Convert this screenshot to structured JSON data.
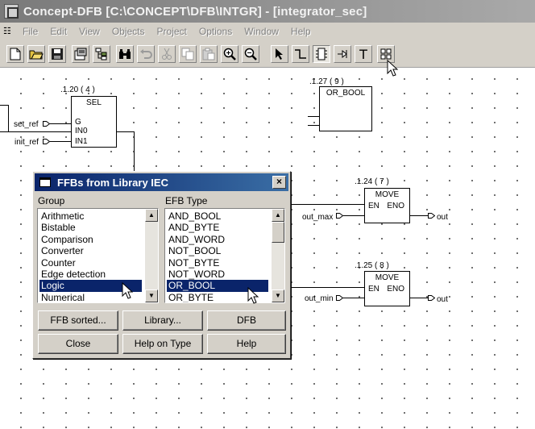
{
  "window": {
    "title": "Concept-DFB [C:\\CONCEPT\\DFB\\INTGR]  - [integrator_sec]"
  },
  "menu": [
    "File",
    "Edit",
    "View",
    "Objects",
    "Project",
    "Options",
    "Window",
    "Help"
  ],
  "toolbar": {
    "icons": [
      "new-file-icon",
      "open-folder-icon",
      "save-icon",
      "properties-icon",
      "hierarchy-icon",
      "binoculars-icon",
      "undo-icon",
      "cut-icon",
      "copy-icon",
      "paste-icon",
      "zoom-in-icon",
      "zoom-out-icon",
      "select-arrow-icon",
      "connect-link-icon",
      "ffb-block-icon",
      "pin-icon",
      "text-icon",
      "ffb-library-icon"
    ],
    "text_tool": "T"
  },
  "diagram": {
    "sel_block": {
      "ref": ".1.20 ( 4 )",
      "title": "SEL",
      "pins": [
        "G",
        "IN0",
        "IN1"
      ]
    },
    "or_block": {
      "ref": ".1.27 ( 9 )",
      "title": "OR_BOOL"
    },
    "move1": {
      "ref": ".1.24 ( 7 )",
      "title": "MOVE",
      "en": "EN",
      "eno": "ENO"
    },
    "move2": {
      "ref": ".1.25 ( 8 )",
      "title": "MOVE",
      "en": "EN",
      "eno": "ENO"
    },
    "vars": {
      "set_ref": "set_ref",
      "init_ref": "init_ref",
      "out_max": "out_max",
      "out_min": "out_min",
      "out1": "out",
      "out2": "out"
    }
  },
  "dialog": {
    "title": "FFBs from Library IEC",
    "close": "×",
    "group_label": "Group",
    "type_label": "EFB Type",
    "groups": [
      "Arithmetic",
      "Bistable",
      "Comparison",
      "Converter",
      "Counter",
      "Edge detection",
      "Logic",
      "Numerical"
    ],
    "selected_group": "Logic",
    "types": [
      "AND_BOOL",
      "AND_BYTE",
      "AND_WORD",
      "NOT_BOOL",
      "NOT_BYTE",
      "NOT_WORD",
      "OR_BOOL",
      "OR_BYTE"
    ],
    "selected_type": "OR_BOOL",
    "buttons": {
      "sorted": "FFB sorted...",
      "library": "Library...",
      "dfb": "DFB",
      "close": "Close",
      "help_type": "Help on Type",
      "help": "Help"
    }
  }
}
